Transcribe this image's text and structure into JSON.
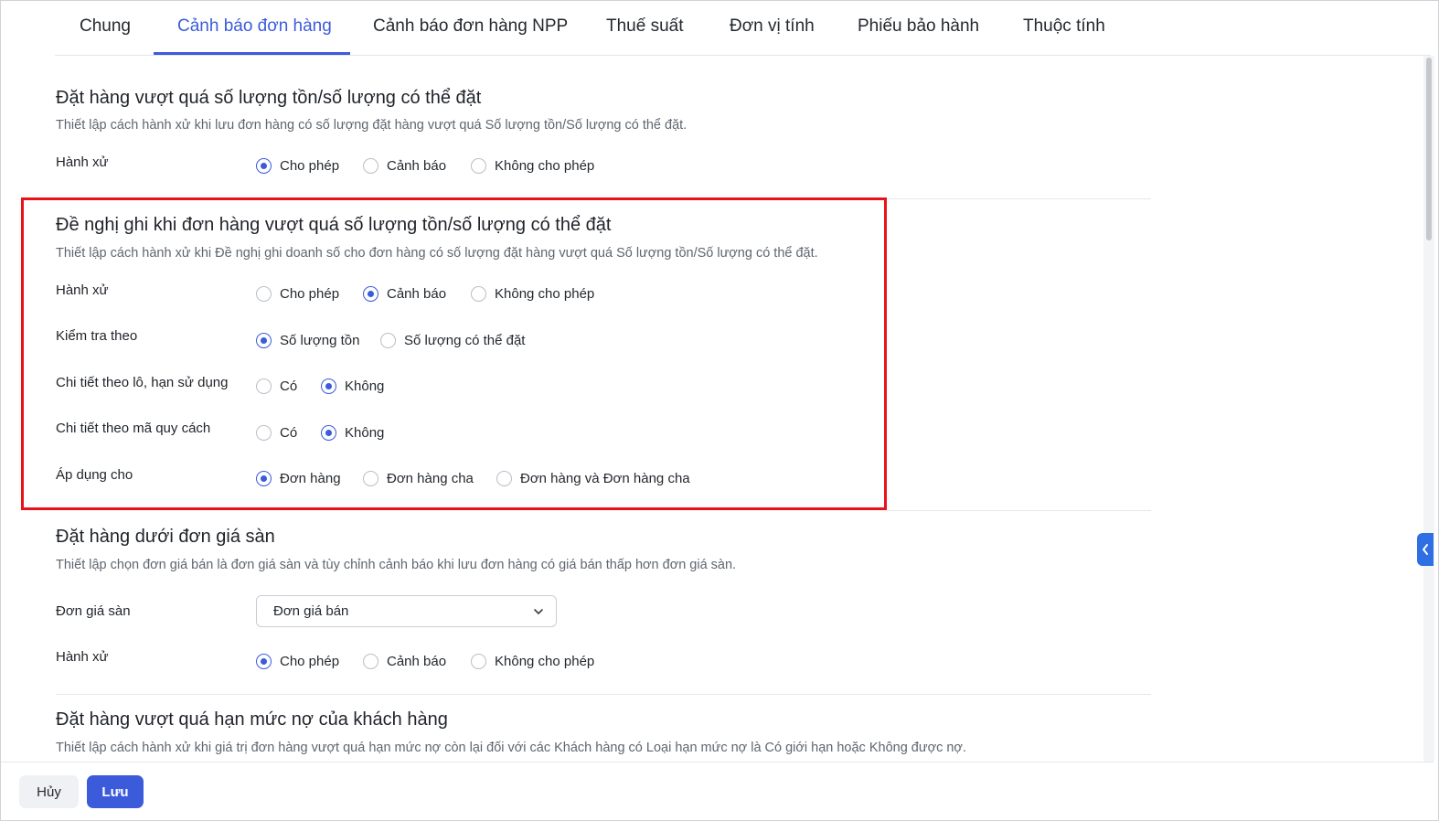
{
  "tabs": [
    {
      "label": "Chung"
    },
    {
      "label": "Cảnh báo đơn hàng"
    },
    {
      "label": "Cảnh báo đơn hàng NPP"
    },
    {
      "label": "Thuế suất"
    },
    {
      "label": "Đơn vị tính"
    },
    {
      "label": "Phiếu bảo hành"
    },
    {
      "label": "Thuộc tính"
    }
  ],
  "active_tab": "Cảnh báo đơn hàng",
  "section1": {
    "title": "Đặt hàng vượt quá số lượng tồn/số lượng có thể đặt",
    "desc": "Thiết lập cách hành xử khi lưu đơn hàng có số lượng đặt hàng vượt quá Số lượng tồn/Số lượng có thể đặt.",
    "behavior_label": "Hành xử",
    "options": [
      "Cho phép",
      "Cảnh báo",
      "Không cho phép"
    ],
    "selected": "Cho phép"
  },
  "section2": {
    "title": "Đề nghị ghi khi đơn hàng vượt quá số lượng tồn/số lượng có thể đặt",
    "desc": "Thiết lập cách hành xử khi Đề nghị ghi doanh số cho đơn hàng có số lượng đặt hàng vượt quá Số lượng tồn/Số lượng có thể đặt.",
    "behavior_label": "Hành xử",
    "behavior_options": [
      "Cho phép",
      "Cảnh báo",
      "Không cho phép"
    ],
    "behavior_selected": "Cảnh báo",
    "check_label": "Kiểm tra theo",
    "check_options": [
      "Số lượng tồn",
      "Số lượng có thể đặt"
    ],
    "check_selected": "Số lượng tồn",
    "lot_label": "Chi tiết theo lô, hạn sử dụng",
    "lot_options": [
      "Có",
      "Không"
    ],
    "lot_selected": "Không",
    "spec_label": "Chi tiết theo mã quy cách",
    "spec_options": [
      "Có",
      "Không"
    ],
    "spec_selected": "Không",
    "apply_label": "Áp dụng cho",
    "apply_options": [
      "Đơn hàng",
      "Đơn hàng cha",
      "Đơn hàng và Đơn hàng cha"
    ],
    "apply_selected": "Đơn hàng"
  },
  "section3": {
    "title": "Đặt hàng dưới đơn giá sàn",
    "desc": "Thiết lập chọn đơn giá bán là đơn giá sàn và tùy chỉnh cảnh báo khi lưu đơn hàng có giá bán thấp hơn đơn giá sàn.",
    "price_label": "Đơn giá sàn",
    "price_value": "Đơn giá bán",
    "behavior_label": "Hành xử",
    "options": [
      "Cho phép",
      "Cảnh báo",
      "Không cho phép"
    ],
    "selected": "Cho phép"
  },
  "section4": {
    "title": "Đặt hàng vượt quá hạn mức nợ của khách hàng",
    "desc": "Thiết lập cách hành xử khi giá trị đơn hàng vượt quá hạn mức nợ còn lại đối với các Khách hàng có Loại hạn mức nợ là Có giới hạn hoặc Không được nợ."
  },
  "footer": {
    "cancel_label": "Hủy",
    "save_label": "Lưu"
  },
  "colors": {
    "accent": "#3b5bdb",
    "highlight_border": "#e8131a",
    "side_toggle": "#2f6fe4"
  },
  "icons": [
    "chevron-down-icon",
    "chevron-left-icon"
  ]
}
